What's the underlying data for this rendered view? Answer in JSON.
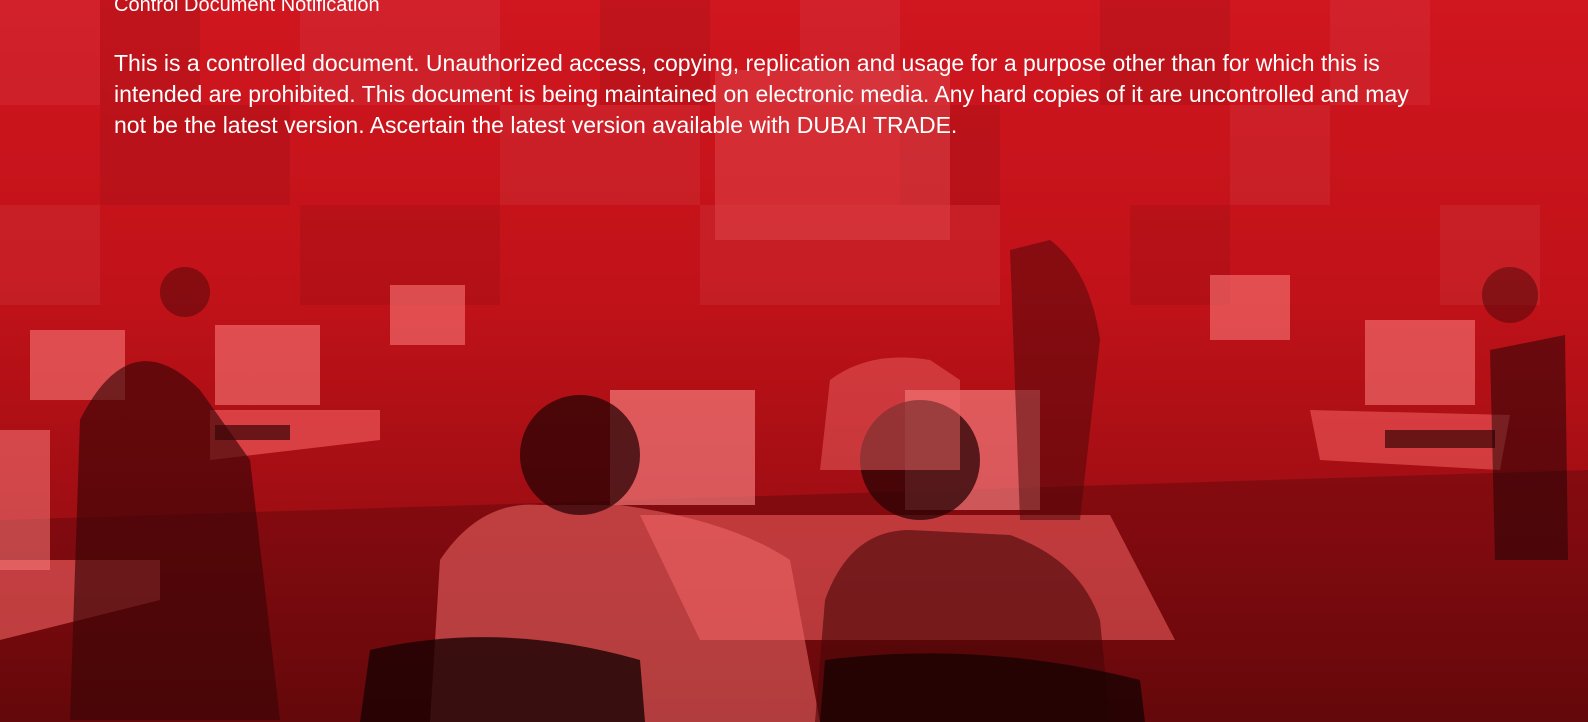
{
  "document": {
    "heading": "Control Document Notification",
    "notice": "This is a controlled document. Unauthorized access, copying, replication and usage for a purpose other than for which this is intended are prohibited. This document is being maintained on electronic media. Any hard copies of it are uncontrolled and may not be the latest version. Ascertain the latest version available with DUBAI TRADE."
  },
  "colors": {
    "background": "#c8141c",
    "text": "#ffffff"
  }
}
